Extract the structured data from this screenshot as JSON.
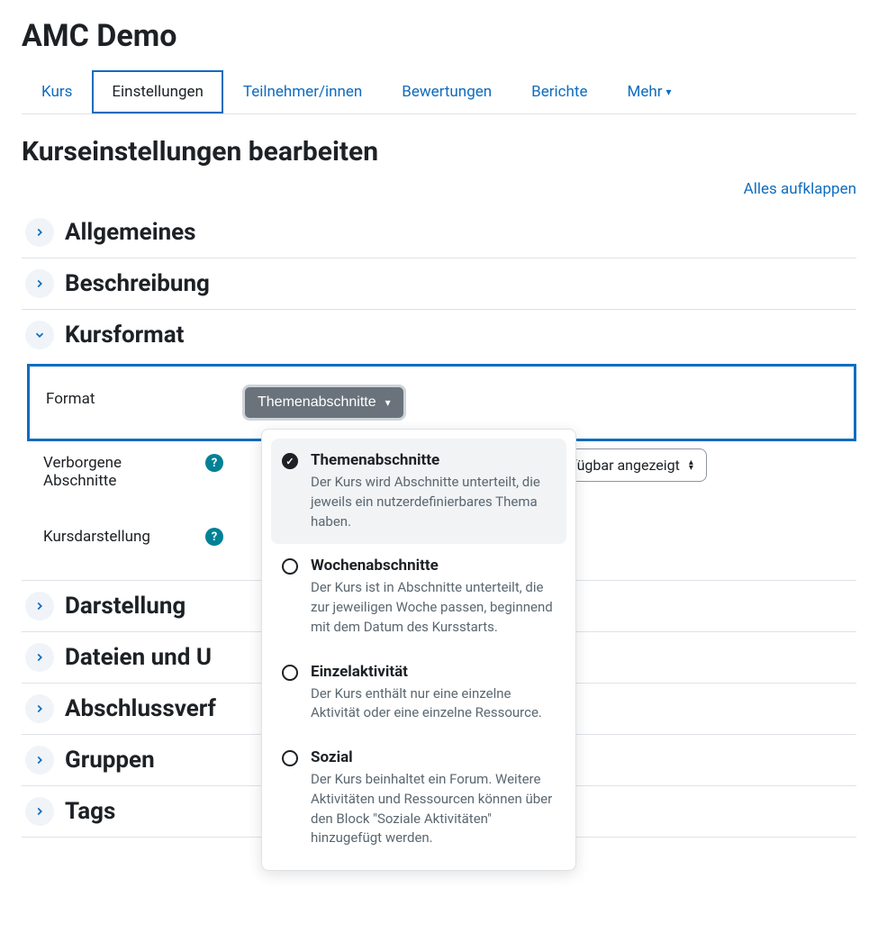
{
  "siteTitle": "AMC Demo",
  "tabs": {
    "kurs": "Kurs",
    "einstellungen": "Einstellungen",
    "teilnehmer": "Teilnehmer/innen",
    "bewertungen": "Bewertungen",
    "berichte": "Berichte",
    "mehr": "Mehr"
  },
  "pageTitle": "Kurseinstellungen bearbeiten",
  "expandAll": "Alles aufklappen",
  "sections": {
    "allgemeines": "Allgemeines",
    "beschreibung": "Beschreibung",
    "kursformat": "Kursformat",
    "darstellung": "Darstellung",
    "dateien": "Dateien und U",
    "abschluss": "Abschlussverf",
    "gruppen": "Gruppen",
    "tags": "Tags"
  },
  "fields": {
    "format": {
      "label": "Format",
      "value": "Themenabschnitte"
    },
    "verborgene": {
      "label": "Verborgene Abschnitte",
      "value": "erfügbar angezeigt"
    },
    "kursdarstellung": {
      "label": "Kursdarstellung"
    }
  },
  "dropdown": {
    "opt1": {
      "title": "Themenabschnitte",
      "desc": "Der Kurs wird Abschnitte unterteilt, die jeweils ein nutzerdefinierbares Thema haben."
    },
    "opt2": {
      "title": "Wochenabschnitte",
      "desc": "Der Kurs ist in Abschnitte unterteilt, die zur jeweiligen Woche passen, beginnend mit dem Datum des Kursstarts."
    },
    "opt3": {
      "title": "Einzelaktivität",
      "desc": "Der Kurs enthält nur eine einzelne Aktivität oder eine einzelne Ressource."
    },
    "opt4": {
      "title": "Sozial",
      "desc": "Der Kurs beinhaltet ein Forum. Weitere Aktivitäten und Ressourcen können über den Block \"Soziale Aktivitäten\" hinzugefügt werden."
    }
  }
}
